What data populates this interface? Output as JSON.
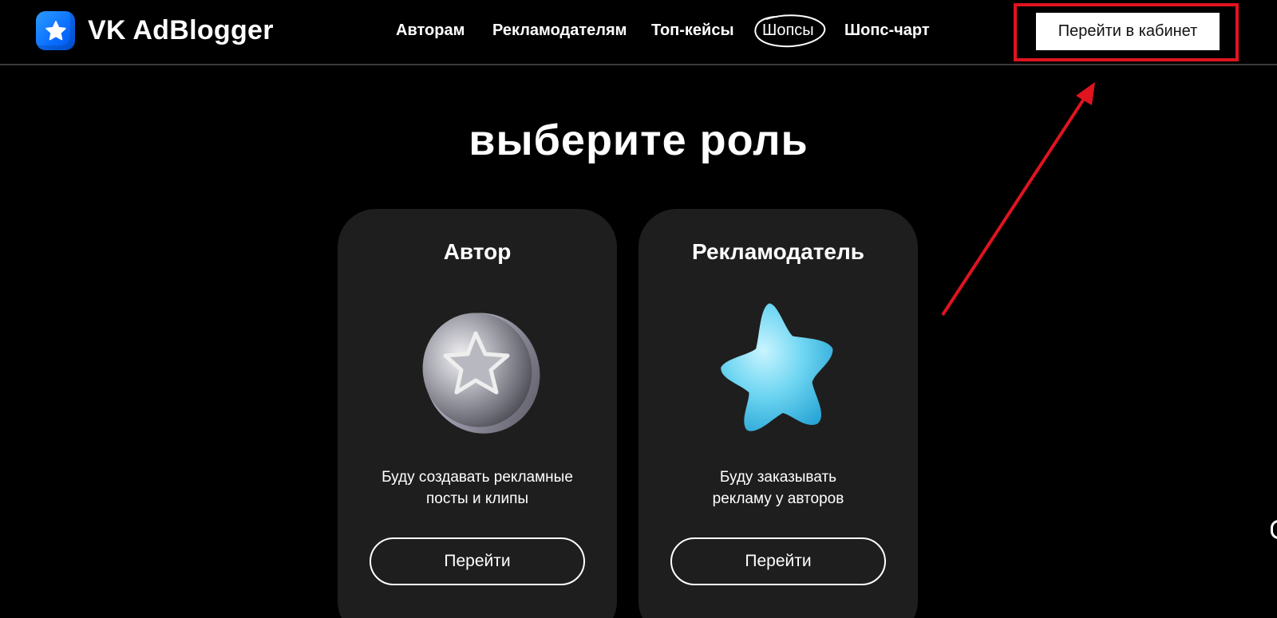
{
  "header": {
    "logo_text": "VK AdBlogger",
    "logo_icon": "star-icon",
    "nav": [
      {
        "label": "Авторам"
      },
      {
        "label": "Рекламодателям"
      },
      {
        "label": "Топ-кейсы"
      },
      {
        "label": "Шопсы"
      },
      {
        "label": "Шопс-чарт"
      }
    ],
    "cabinet_button": "Перейти в кабинет"
  },
  "main": {
    "title": "выберите роль",
    "cards": [
      {
        "title": "Автор",
        "image": "silver-star-coin",
        "description_line1": "Буду создавать рекламные",
        "description_line2": "посты и клипы",
        "button": "Перейти"
      },
      {
        "title": "Рекламодатель",
        "image": "blue-star",
        "description_line1": "Буду заказывать",
        "description_line2": "рекламу у авторов",
        "button": "Перейти"
      }
    ]
  },
  "colors": {
    "background": "#000000",
    "card": "#1e1e1e",
    "accent_blue": "#0a6dff",
    "annotation_red": "#e0141f"
  }
}
